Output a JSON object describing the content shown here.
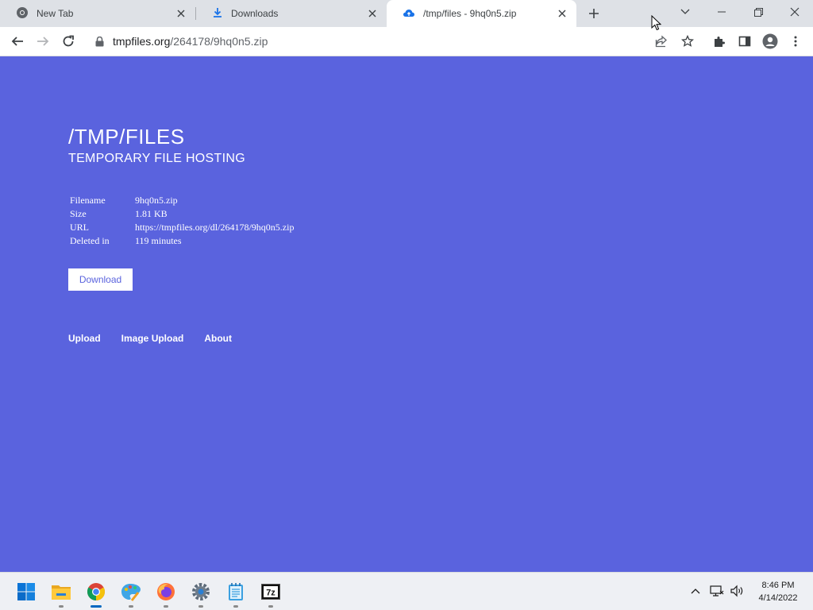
{
  "browser": {
    "tabs": [
      {
        "title": "New Tab",
        "icon": "chrome-icon"
      },
      {
        "title": "Downloads",
        "icon": "download-icon"
      },
      {
        "title": "/tmp/files - 9hq0n5.zip",
        "icon": "cloud-upload-icon",
        "active": true
      }
    ],
    "url_host": "tmpfiles.org",
    "url_path": "/264178/9hq0n5.zip"
  },
  "page": {
    "title": "/TMP/FILES",
    "subtitle": "TEMPORARY FILE HOSTING",
    "info": [
      {
        "key": "Filename",
        "value": "9hq0n5.zip"
      },
      {
        "key": "Size",
        "value": "1.81 KB"
      },
      {
        "key": "URL",
        "value": "https://tmpfiles.org/dl/264178/9hq0n5.zip"
      },
      {
        "key": "Deleted in",
        "value": "119 minutes"
      }
    ],
    "download_label": "Download",
    "nav": [
      "Upload",
      "Image Upload",
      "About"
    ],
    "accent": "#5a63de"
  },
  "taskbar": {
    "apps": [
      "windows-start-icon",
      "file-explorer-icon",
      "chrome-icon",
      "paint-icon",
      "firefox-icon",
      "settings-icon",
      "notepad-icon",
      "7zip-icon"
    ],
    "sevenzip_label": "7z",
    "time": "8:46 PM",
    "date": "4/14/2022"
  }
}
